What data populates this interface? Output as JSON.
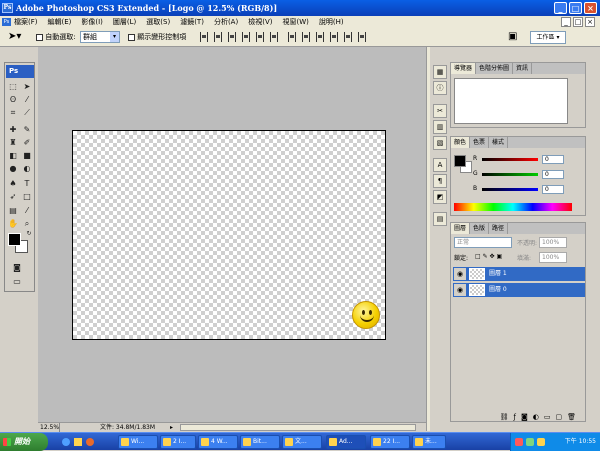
{
  "window": {
    "title": "Adobe Photoshop CS3 Extended - [Logo @ 12.5% (RGB/8)]",
    "app_icon": "Ps"
  },
  "menu": [
    "檔案(F)",
    "編輯(E)",
    "影像(I)",
    "圖層(L)",
    "選取(S)",
    "濾鏡(T)",
    "分析(A)",
    "檢視(V)",
    "視窗(W)",
    "說明(H)"
  ],
  "options": {
    "auto_select_label": "自動選取:",
    "group_value": "群組",
    "show_transform_label": "顯示變形控制項",
    "workspace_label": "工作區 ▾"
  },
  "toolbox": {
    "logo": "Ps"
  },
  "status": {
    "zoom": "12.5%",
    "doc_info": "文件: 34.8M/1.83M"
  },
  "panels": {
    "navigator_tabs": [
      "導覽器",
      "色階分佈圖",
      "資訊"
    ],
    "color_tabs": [
      "顏色",
      "色票",
      "樣式"
    ],
    "color_values": [
      {
        "label": "R",
        "value": "0"
      },
      {
        "label": "G",
        "value": "0"
      },
      {
        "label": "B",
        "value": "0"
      }
    ],
    "layers_tabs": [
      "圖層",
      "色版",
      "路徑"
    ],
    "blend_mode": "正常",
    "opacity_label": "不透明:",
    "opacity_value": "100%",
    "lock_label": "鎖定:",
    "fill_label": "填滿:",
    "fill_value": "100%",
    "layers": [
      {
        "name": "圖層 1"
      },
      {
        "name": "圖層 0"
      }
    ]
  },
  "taskbar": {
    "start_label": "開始",
    "buttons": [
      "Wi...",
      "2 I...",
      "4 W...",
      "Bit...",
      "文...",
      "Ad...",
      "22 I...",
      "未..."
    ],
    "clock": "下午 10:55"
  }
}
